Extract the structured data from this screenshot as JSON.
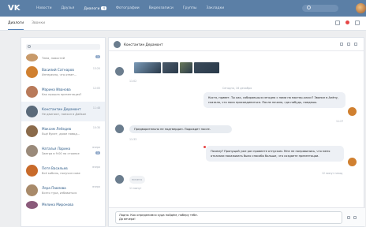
{
  "topbar": {
    "logo": "VK",
    "nav": [
      {
        "label": "Новости",
        "active": false
      },
      {
        "label": "Друзья",
        "active": false
      },
      {
        "label": "Диалоги",
        "active": true,
        "badge": "4"
      },
      {
        "label": "Фотографии",
        "active": false
      },
      {
        "label": "Видеозаписи",
        "active": false
      },
      {
        "label": "Группы",
        "active": false
      },
      {
        "label": "Закладки",
        "active": false
      }
    ]
  },
  "subbar": {
    "tabs": [
      "Диалоги",
      "Звонки"
    ]
  },
  "colors": {
    "topbar": "#5b7fa6",
    "accent": "#5181b8",
    "selected_row": "#eef2f7",
    "unread": "#e64646"
  },
  "conversations": [
    {
      "name": "",
      "preview": "Тема, новостей",
      "time": "",
      "badge": "1",
      "avatar": "#c89a6a",
      "partial": true,
      "selected": false
    },
    {
      "name": "Василий Сатнаров",
      "preview": "Интересно, что ответ...",
      "time": "13:20",
      "badge": "",
      "avatar": "#d08030",
      "selected": false
    },
    {
      "name": "Марина Иванова",
      "preview": "Как прошла презентация?",
      "time": "12:05",
      "badge": "",
      "avatar": "#b87a5a",
      "selected": false
    },
    {
      "name": "Константин Дерамонт",
      "preview": "Не двигают, поехал в Дайкон",
      "time": "11:48",
      "badge": "",
      "avatar": "#5a6a7a",
      "selected": true
    },
    {
      "name": "Максим Лебедев",
      "preview": "Ещё букет, даже повод...",
      "time": "10:30",
      "badge": "",
      "avatar": "#8a6a4a",
      "selected": false
    },
    {
      "name": "Наталья Ларина",
      "preview": "Завтра в 9:00 на стоянке",
      "time": "вчера",
      "badge": "1",
      "avatar": "#9a8a7a",
      "selected": false
    },
    {
      "name": "Петя Васильев",
      "preview": "Всё кабель, получил сове",
      "time": "вчера",
      "badge": "",
      "avatar": "#c86a2a",
      "selected": false
    },
    {
      "name": "Лера Павлова",
      "preview": "Всего тура, избавиться",
      "time": "вчера",
      "badge": "",
      "avatar": "#a88a6a",
      "selected": false
    },
    {
      "name": "Мелина Миронова",
      "preview": "",
      "time": "",
      "badge": "",
      "avatar": "#8a5a7a",
      "partial": true,
      "selected": false
    }
  ],
  "chat": {
    "contact": "Константин Дерамонт",
    "photo_colors": [
      "#7a9ab8",
      "#4a5a6a",
      "#6a7a5a",
      "#3a4a5a"
    ],
    "photo_time": "11:02",
    "day_separator": "Сегодня, 16 декабря",
    "messages": [
      {
        "text": "Костя, привет. Ты как, собираешься сегодня с нами на мастер-класс? Звонил в Алёну, сказала, что пока присоединиться. После начала, где-нибудь, поедешь.",
        "time": "11:27",
        "out": true
      },
      {
        "text": "Предварительно не подтвердил. Подождет после.",
        "time": "11:33",
        "out": false
      },
      {
        "text": "Почему? Пропущай уже раз провеете отпуском. Мне не понравились, что меня отказали показывать было спасибо больше, что создаете презентации.",
        "time": "12 минут назад",
        "out": true
      },
      {
        "text": "ничего",
        "time": "11 минут",
        "out": false
      }
    ],
    "composer_text": "Ладно. Как определимся куда пойдём, наберу тебе.\nДо вечера!"
  }
}
